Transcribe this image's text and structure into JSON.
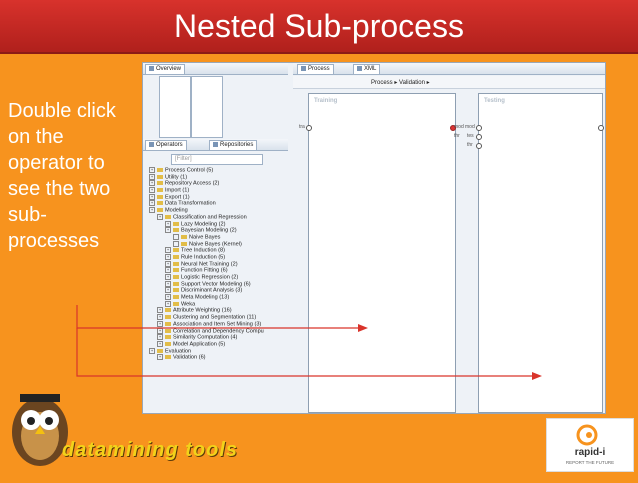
{
  "slide": {
    "title": "Nested Sub-process",
    "side_text": "Double click on the operator to see the two sub-processes"
  },
  "screenshot": {
    "overview_tab": "Overview",
    "operators_tab": "Operators",
    "repositories_tab": "Repositories",
    "process_tab": "Process",
    "xml_tab": "XML",
    "breadcrumb": [
      "Process",
      "Validation"
    ],
    "filter_placeholder": "[Filter]",
    "training_label": "Training",
    "testing_label": "Testing",
    "left_port_label": "tra",
    "mid_labels": [
      "mod",
      "mod",
      "thr",
      "tes",
      "thr"
    ],
    "tree": [
      {
        "label": "Process Control (5)",
        "depth": 0
      },
      {
        "label": "Utility (1)",
        "depth": 0
      },
      {
        "label": "Repository Access (2)",
        "depth": 0
      },
      {
        "label": "Import (1)",
        "depth": 0
      },
      {
        "label": "Export (1)",
        "depth": 0
      },
      {
        "label": "Data Transformation",
        "depth": 0
      },
      {
        "label": "Modeling",
        "depth": 0
      },
      {
        "label": "Classification and Regression",
        "depth": 1
      },
      {
        "label": "Lazy Modeling (2)",
        "depth": 2
      },
      {
        "label": "Bayesian Modeling (2)",
        "depth": 2
      },
      {
        "label": "Naive Bayes",
        "depth": 3
      },
      {
        "label": "Naive Bayes (Kernel)",
        "depth": 3
      },
      {
        "label": "Tree Induction (8)",
        "depth": 2
      },
      {
        "label": "Rule Induction (5)",
        "depth": 2
      },
      {
        "label": "Neural Net Training (2)",
        "depth": 2
      },
      {
        "label": "Function Fitting (6)",
        "depth": 2
      },
      {
        "label": "Logistic Regression (2)",
        "depth": 2
      },
      {
        "label": "Support Vector Modeling (6)",
        "depth": 2
      },
      {
        "label": "Discriminant Analysis (3)",
        "depth": 2
      },
      {
        "label": "Meta Modeling (13)",
        "depth": 2
      },
      {
        "label": "Weka",
        "depth": 2
      },
      {
        "label": "Attribute Weighting (16)",
        "depth": 1
      },
      {
        "label": "Clustering and Segmentation (11)",
        "depth": 1
      },
      {
        "label": "Association and Item Set Mining (3)",
        "depth": 1
      },
      {
        "label": "Correlation and Dependency Compu",
        "depth": 1
      },
      {
        "label": "Similarity Computation (4)",
        "depth": 1
      },
      {
        "label": "Model Application (5)",
        "depth": 1
      },
      {
        "label": "Evaluation",
        "depth": 0
      },
      {
        "label": "Validation (6)",
        "depth": 1
      }
    ]
  },
  "logo_left": "datamining tools",
  "logo_right": {
    "name": "rapid-i",
    "tagline": "REPORT THE FUTURE"
  },
  "colors": {
    "background": "#f7931e",
    "title_bar": "#c62a24",
    "arrow": "#d9342b"
  }
}
